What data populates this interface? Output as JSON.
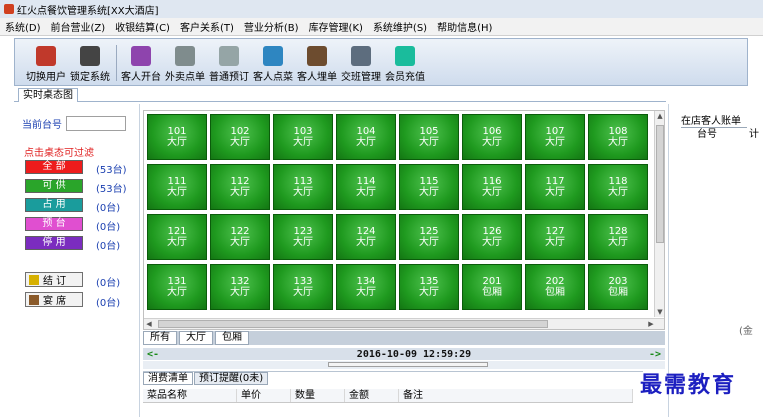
{
  "window": {
    "title": "红火点餐饮管理系统[XX大酒店]"
  },
  "menu": [
    "系统(D)",
    "前台营业(Z)",
    "收银结算(C)",
    "客户关系(T)",
    "营业分析(B)",
    "库存管理(K)",
    "系统维护(S)",
    "帮助信息(H)"
  ],
  "toolbar": {
    "groups": [
      [
        {
          "label": "切换用户",
          "icon": "user-switch-icon",
          "color": "#c0392b"
        },
        {
          "label": "锁定系统",
          "icon": "lock-icon",
          "color": "#444444"
        }
      ],
      [
        {
          "label": "客人开台",
          "icon": "open-table-icon",
          "color": "#8e44ad"
        },
        {
          "label": "外卖点单",
          "icon": "printer-icon",
          "color": "#7f8c8d"
        },
        {
          "label": "普通预订",
          "icon": "reservation-icon",
          "color": "#95a5a6"
        },
        {
          "label": "客人点菜",
          "icon": "order-icon",
          "color": "#2e86c1"
        },
        {
          "label": "客人埋单",
          "icon": "money-bag-icon",
          "color": "#6d4c2f"
        },
        {
          "label": "交班管理",
          "icon": "handover-icon",
          "color": "#5d6d7e"
        },
        {
          "label": "会员充值",
          "icon": "plus-icon",
          "color": "#1abc9c"
        }
      ]
    ]
  },
  "tabs": {
    "main": "实时桌态图"
  },
  "left_panel": {
    "table_no_label": "当前台号",
    "table_no_value": "",
    "filter_title": "点击桌态可过滤",
    "filters": [
      {
        "label": "全 部",
        "count": "(53台)",
        "color": "#ee1c1c"
      },
      {
        "label": "可 供",
        "count": "(53台)",
        "color": "#2aa52a"
      },
      {
        "label": "占 用",
        "count": "(0台)",
        "color": "#1a9c9c"
      },
      {
        "label": "预 台",
        "count": "(0台)",
        "color": "#e04fd0"
      },
      {
        "label": "停 用",
        "count": "(0台)",
        "color": "#7b2cbf"
      }
    ],
    "actions": [
      {
        "label": "结 订",
        "count": "(0台)",
        "icon": "arrow-right-icon"
      },
      {
        "label": "宴 席",
        "count": "(0台)",
        "icon": "banquet-icon"
      }
    ]
  },
  "tables": [
    {
      "number": "101",
      "area": "大厅"
    },
    {
      "number": "102",
      "area": "大厅"
    },
    {
      "number": "103",
      "area": "大厅"
    },
    {
      "number": "104",
      "area": "大厅"
    },
    {
      "number": "105",
      "area": "大厅"
    },
    {
      "number": "106",
      "area": "大厅"
    },
    {
      "number": "107",
      "area": "大厅"
    },
    {
      "number": "108",
      "area": "大厅"
    },
    {
      "number": "111",
      "area": "大厅"
    },
    {
      "number": "112",
      "area": "大厅"
    },
    {
      "number": "113",
      "area": "大厅"
    },
    {
      "number": "114",
      "area": "大厅"
    },
    {
      "number": "115",
      "area": "大厅"
    },
    {
      "number": "116",
      "area": "大厅"
    },
    {
      "number": "117",
      "area": "大厅"
    },
    {
      "number": "118",
      "area": "大厅"
    },
    {
      "number": "121",
      "area": "大厅"
    },
    {
      "number": "122",
      "area": "大厅"
    },
    {
      "number": "123",
      "area": "大厅"
    },
    {
      "number": "124",
      "area": "大厅"
    },
    {
      "number": "125",
      "area": "大厅"
    },
    {
      "number": "126",
      "area": "大厅"
    },
    {
      "number": "127",
      "area": "大厅"
    },
    {
      "number": "128",
      "area": "大厅"
    },
    {
      "number": "131",
      "area": "大厅"
    },
    {
      "number": "132",
      "area": "大厅"
    },
    {
      "number": "133",
      "area": "大厅"
    },
    {
      "number": "134",
      "area": "大厅"
    },
    {
      "number": "135",
      "area": "大厅"
    },
    {
      "number": "201",
      "area": "包厢"
    },
    {
      "number": "202",
      "area": "包厢"
    },
    {
      "number": "203",
      "area": "包厢"
    }
  ],
  "area_tabs": [
    "所有",
    "大厅",
    "包厢"
  ],
  "status_bar": {
    "left_arrow": "<-",
    "datetime": "2016-10-09 12:59:29",
    "right_arrow": "->"
  },
  "bottom_panel": {
    "tabs": [
      "消费清单",
      "预订提醒(0未)"
    ],
    "headers": [
      "菜品名称",
      "单价",
      "数量",
      "金额",
      "备注"
    ]
  },
  "right_panel": {
    "tab": "在店客人账单",
    "col1": "台号",
    "col2": "计",
    "side_text": "(金"
  },
  "watermark": "最需教育"
}
